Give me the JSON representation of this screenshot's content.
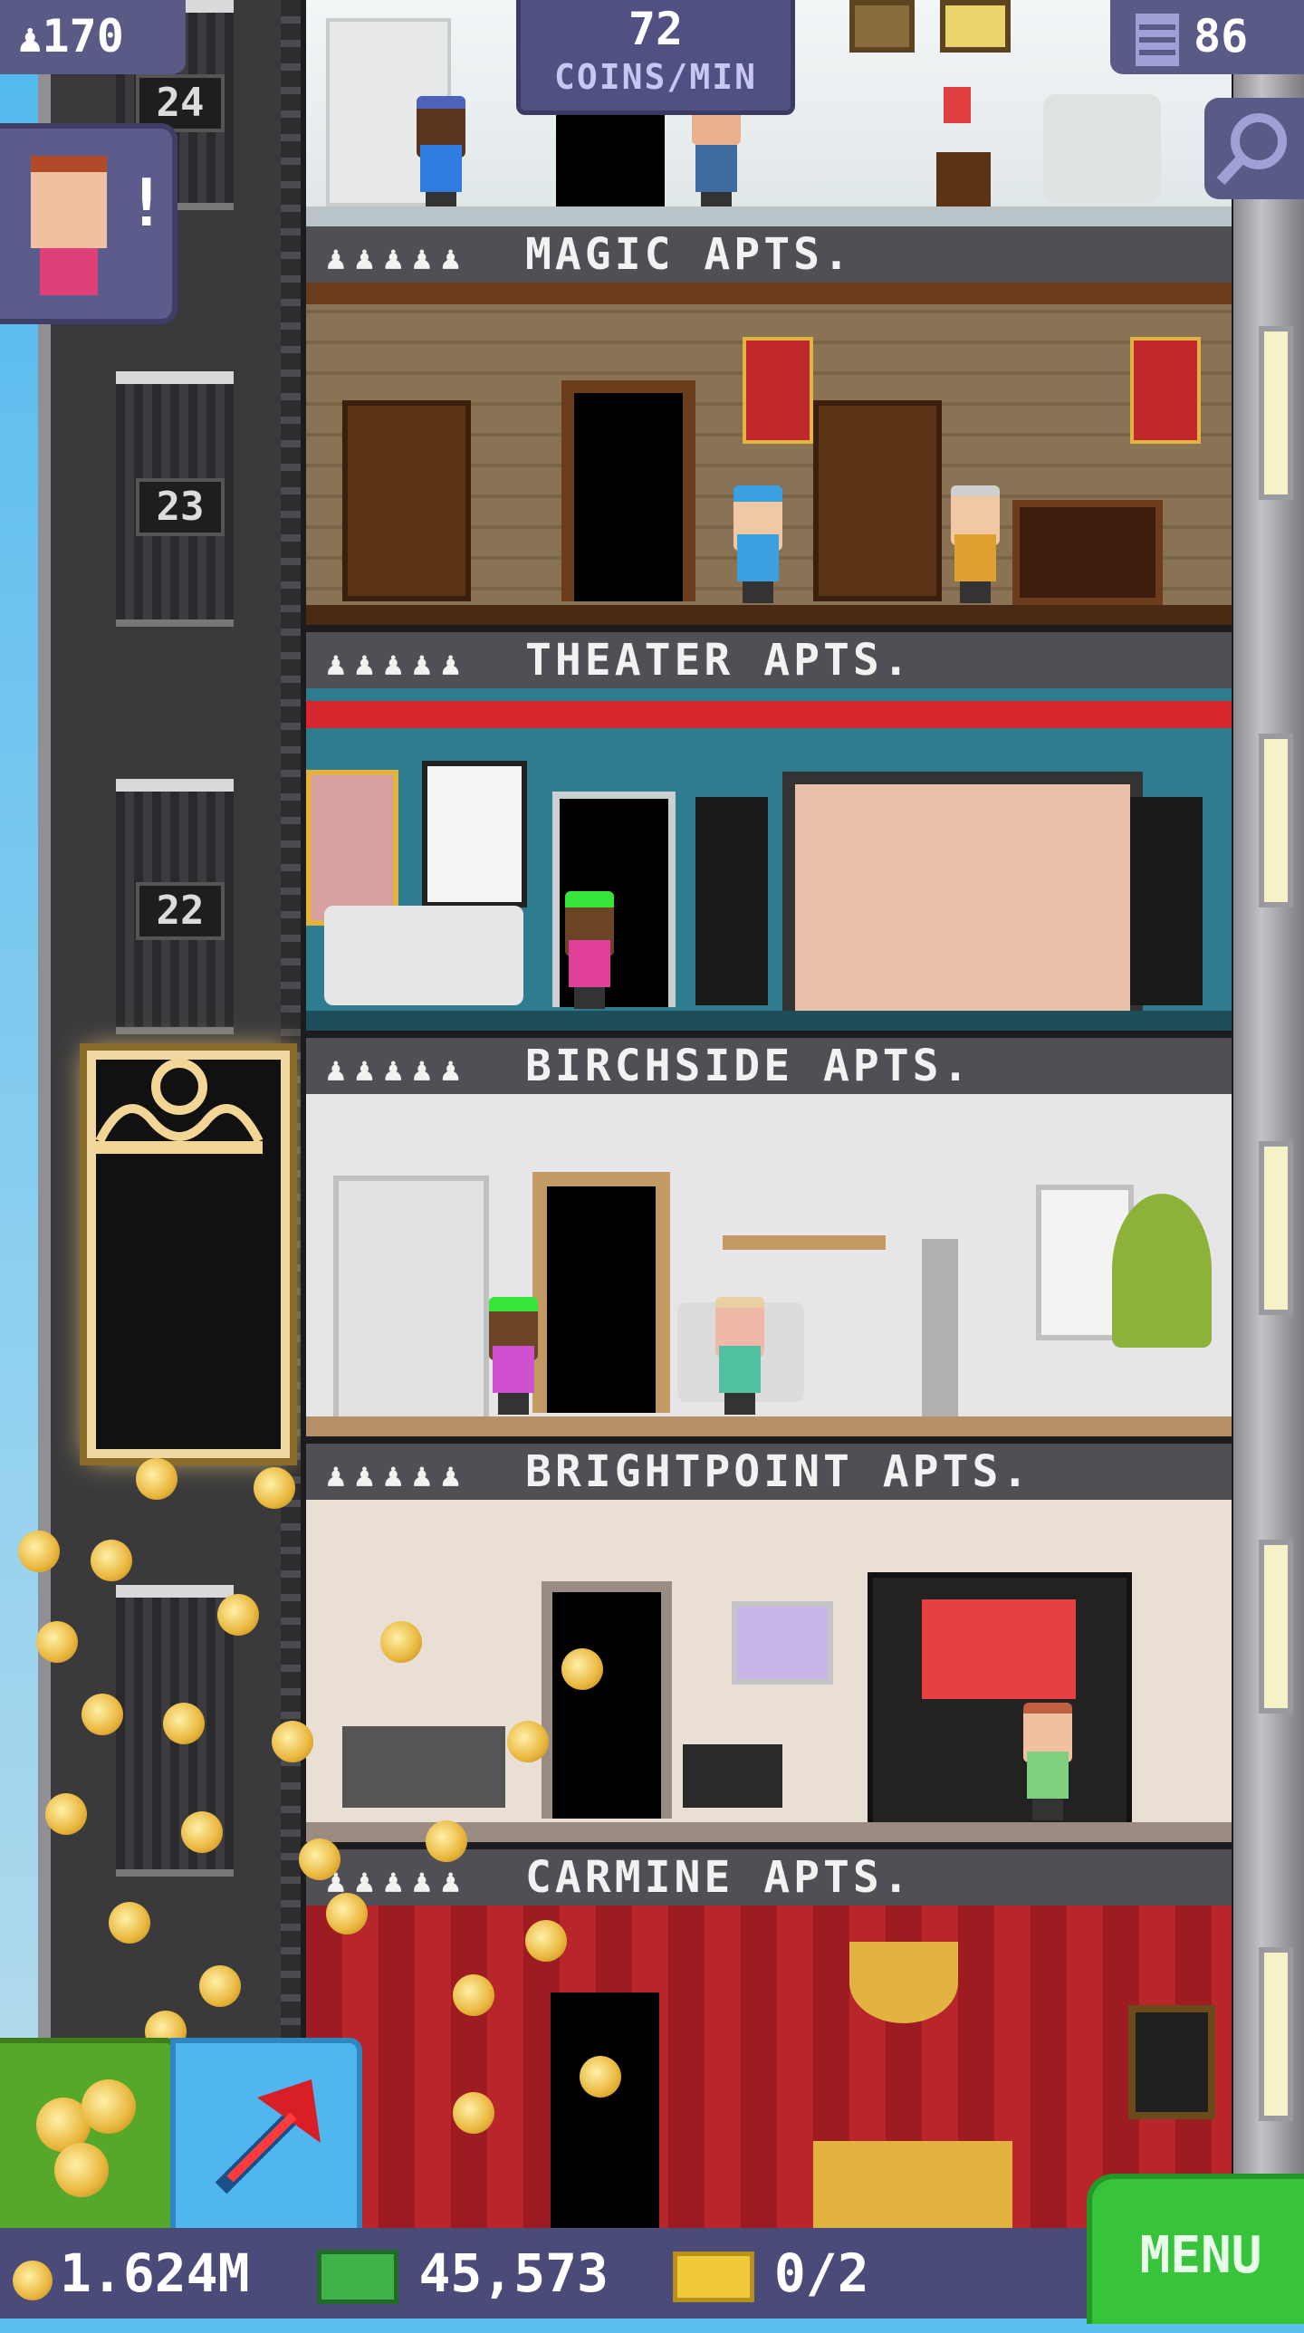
{
  "top_bar": {
    "population": "170",
    "coins_per_min_value": "72",
    "coins_per_min_label": "COINS/MIN",
    "floor_count": "86"
  },
  "elevator": {
    "floor_numbers": [
      "24",
      "23",
      "22"
    ]
  },
  "floors": [
    {
      "name": "MAGIC APTS.",
      "residents_icon": "♟♟♟♟♟"
    },
    {
      "name": "THEATER APTS.",
      "residents_icon": "♟♟♟♟♟"
    },
    {
      "name": "BIRCHSIDE APTS.",
      "residents_icon": "♟♟♟♟♟"
    },
    {
      "name": "BRIGHTPOINT APTS.",
      "residents_icon": "♟♟♟♟♟"
    },
    {
      "name": "CARMINE APTS.",
      "residents_icon": "♟♟♟♟♟"
    }
  ],
  "vip": {
    "alert": "!"
  },
  "bottom_bar": {
    "coins": "1.624M",
    "bux": "45,573",
    "tickets": "0/2",
    "menu_label": "MENU"
  },
  "icons": {
    "population": "person-icon",
    "floors": "building-icon",
    "zoom": "magnifier-icon",
    "coins": "coin-icon",
    "bux": "banknote-icon",
    "tickets": "ticket-icon",
    "build": "arrow-up-icon"
  },
  "colors": {
    "accent_purple": "#505082",
    "menu_green": "#37c33a",
    "coin_gold": "#e9b63c",
    "build_blue": "#4fb6f0"
  }
}
